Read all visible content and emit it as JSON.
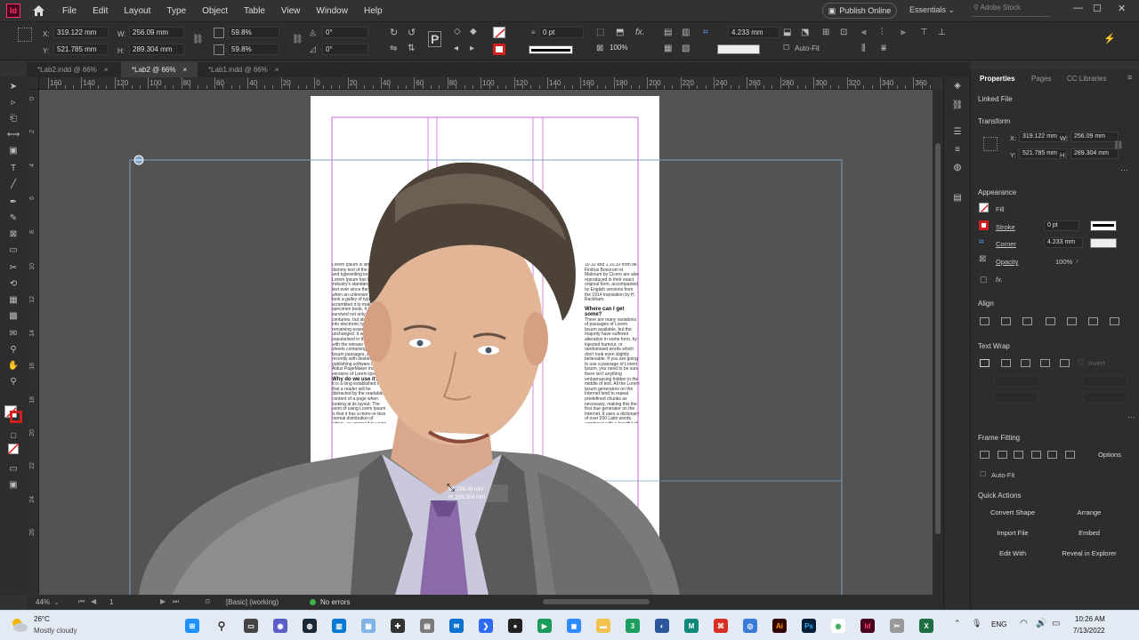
{
  "app": {
    "logo_text": "Id",
    "menus": [
      "File",
      "Edit",
      "Layout",
      "Type",
      "Object",
      "Table",
      "View",
      "Window",
      "Help"
    ],
    "publish_label": "Publish Online",
    "workspace": "Essentials",
    "stock_placeholder": "Adobe Stock",
    "window_controls": [
      "—",
      "☐",
      "✕"
    ]
  },
  "control_bar": {
    "x_label": "X:",
    "x_value": "319.122 mm",
    "y_label": "Y:",
    "y_value": "521.785 mm",
    "w_label": "W:",
    "w_value": "256.09 mm",
    "h_label": "H:",
    "h_value": "289.304 mm",
    "scale_x": "59.8%",
    "scale_y": "59.8%",
    "rotate": "0°",
    "shear": "0°",
    "stroke_weight": "0 pt",
    "opacity": "100%",
    "corner_value": "4.233 mm",
    "auto_fit_label": "Auto-Fit"
  },
  "tabs": [
    {
      "label": "*Lab2.indd @ 66%",
      "close": "×",
      "active": false
    },
    {
      "label": "*Lab2 @ 66%",
      "close": "×",
      "active": true
    },
    {
      "label": "*Lab1.indd @ 66%",
      "close": "×",
      "active": false
    }
  ],
  "rulers": {
    "h_labels": [
      "160",
      "140",
      "120",
      "100",
      "80",
      "60",
      "40",
      "20",
      "0",
      "20",
      "40",
      "60",
      "80",
      "100",
      "120",
      "140",
      "160",
      "180",
      "200",
      "220",
      "240",
      "260",
      "280",
      "300",
      "320",
      "340",
      "360"
    ],
    "v_labels": [
      "0",
      "2",
      "4",
      "6",
      "8",
      "10",
      "12",
      "14",
      "16",
      "18",
      "20",
      "22",
      "24",
      "26"
    ]
  },
  "document": {
    "text_left": "Lorem Ipsum is simply dummy text of the printing and typesetting industry. Lorem Ipsum has been the industry's standard dummy text ever since the 1500s, when an unknown printer took a galley of type and scrambled it to make a type specimen book. It has survived not only five centuries, but also the leap into electronic typesetting, remaining essentially unchanged. It was popularised in the 1960s with the release of Letraset sheets containing Lorem Ipsum passages, and more recently with desktop publishing software like Aldus PageMaker including versions of Lorem Ipsum.",
    "heading_left": "Why do we use it?",
    "text_left_2": "It is a long established fact that a reader will be distracted by the readable content of a page when looking at its layout. The point of using Lorem Ipsum is that it has a more-or-less normal distribution of letters, as opposed to using 'Content here, content here', making it look like readable English. Many desktop publishing packages and web page editors now use Lorem Ipsum as their default model text.",
    "text_right": "10.32 and 1.10.33 from de Finibus Bonorum et Malorum by Cicero are also reproduced in their exact original form, accompanied by English versions from the 1914 translation by H. Rackham.",
    "heading_right": "Where can I get some?",
    "text_right_2": "There are many variations of passages of Lorem Ipsum available, but the majority have suffered alteration in some form, by injected humour, or randomised words which don't look even slightly believable. If you are going to use a passage of Lorem Ipsum, you need to be sure there isn't anything embarrassing hidden in the middle of text. All the Lorem Ipsum generators on the Internet tend to repeat predefined chunks as necessary, making this the first true generator on the Internet. It uses a dictionary of over 200 Latin words, combined with a handful of model sentence structures, to generate Lorem Ipsum which looks reasonable. The generated Lorem Ipsum is therefore always free from repetition, injected humour, or non-characteristic words etc.",
    "tooltip_w": "W: 256.09 mm",
    "tooltip_h": "H: 289.304 mm"
  },
  "status_bar": {
    "zoom": "44%",
    "page": "1",
    "style": "[Basic] (working)",
    "errors": "No errors"
  },
  "panel": {
    "tabs": [
      "Properties",
      "Pages",
      "CC Libraries"
    ],
    "linked_file": "Linked File",
    "transform": "Transform",
    "x_label": "X:",
    "x_value": "319.122 mm",
    "y_label": "Y:",
    "y_value": "521.785 mm",
    "w_label": "W:",
    "w_value": "256.09 mm",
    "h_label": "H:",
    "h_value": "289.304 mm",
    "appearance": "Appearance",
    "fill": "Fill",
    "stroke": "Stroke",
    "stroke_value": "0 pt",
    "corner": "Corner",
    "corner_value": "4.233 mm",
    "opacity": "Opacity",
    "opacity_value": "100%",
    "fx": "fx.",
    "align": "Align",
    "text_wrap": "Text Wrap",
    "invert": "Invert",
    "frame_fitting": "Frame Fitting",
    "options": "Options",
    "auto_fit": "Auto-Fit",
    "quick_actions": "Quick Actions",
    "actions": [
      "Convert Shape",
      "Arrange",
      "Import File",
      "Embed",
      "Edit With",
      "Reveal in Explorer"
    ]
  },
  "taskbar": {
    "temp": "26°C",
    "weather": "Mostly cloudy",
    "lang": "ENG",
    "time": "10:26 AM",
    "date": "7/13/2022"
  },
  "colors": {
    "indesign": "#ff3366",
    "guides": "#7aa0c4",
    "frame": "#c86ad6"
  }
}
